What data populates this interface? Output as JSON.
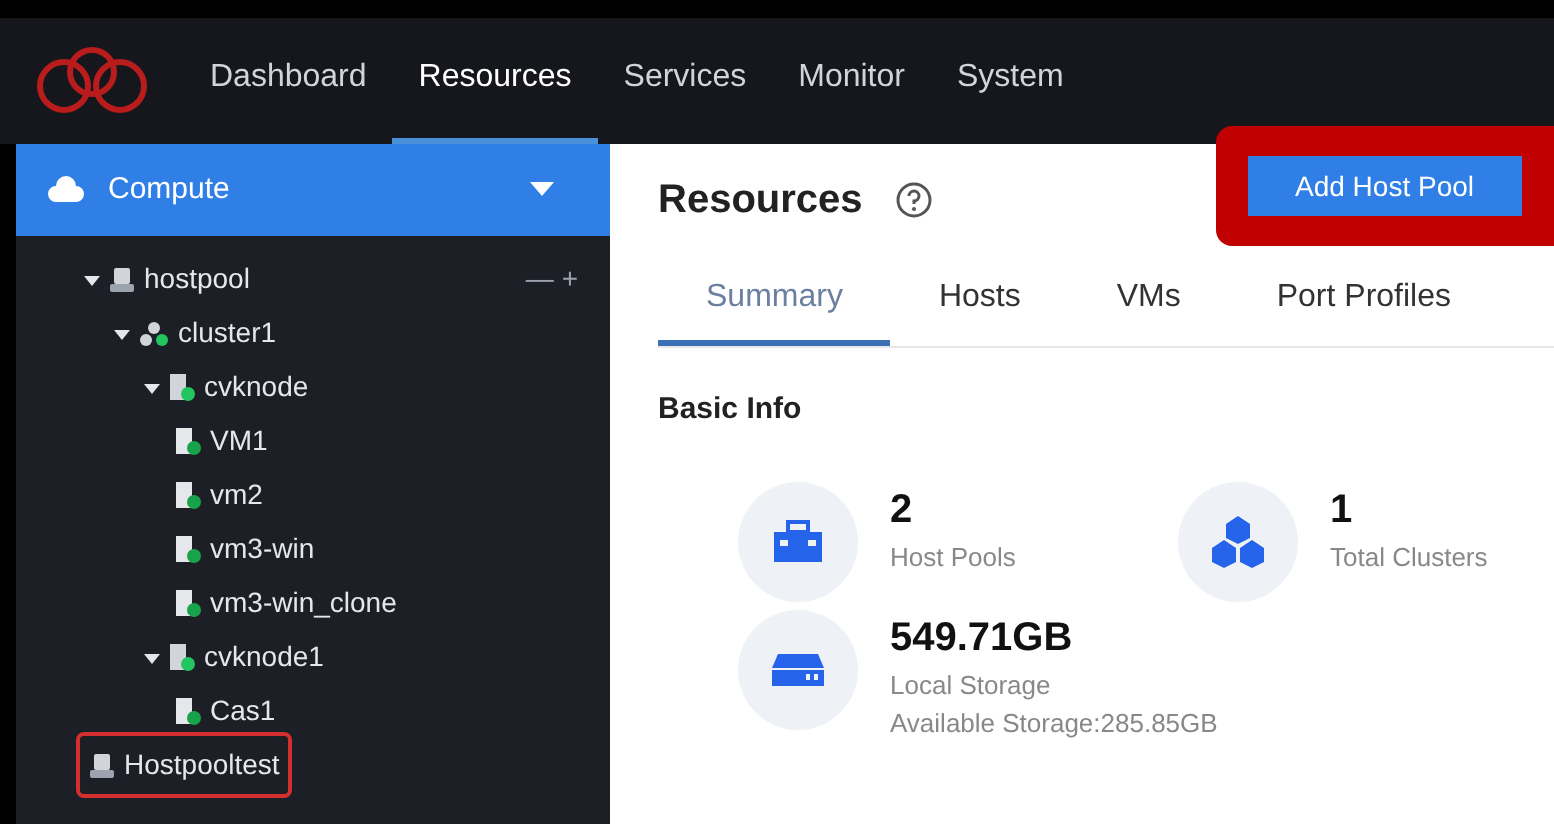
{
  "nav": {
    "items": [
      {
        "label": "Dashboard",
        "selected": false
      },
      {
        "label": "Resources",
        "selected": true
      },
      {
        "label": "Services",
        "selected": false
      },
      {
        "label": "Monitor",
        "selected": false
      },
      {
        "label": "System",
        "selected": false
      }
    ]
  },
  "sidebar": {
    "section": "Compute",
    "tree_controls": [
      "—",
      "+"
    ],
    "tree": [
      {
        "label": "hostpool",
        "kind": "pool",
        "expanded": true,
        "highlighted": false,
        "children": [
          {
            "label": "cluster1",
            "kind": "cluster",
            "expanded": true,
            "highlighted": false,
            "children": [
              {
                "label": "cvknode",
                "kind": "host",
                "expanded": true,
                "highlighted": false,
                "children": [
                  {
                    "label": "VM1",
                    "kind": "vm",
                    "highlighted": false
                  },
                  {
                    "label": "vm2",
                    "kind": "vm",
                    "highlighted": false
                  },
                  {
                    "label": "vm3-win",
                    "kind": "vm",
                    "highlighted": false
                  },
                  {
                    "label": "vm3-win_clone",
                    "kind": "vm",
                    "highlighted": false
                  }
                ]
              },
              {
                "label": "cvknode1",
                "kind": "host",
                "expanded": true,
                "highlighted": false,
                "children": [
                  {
                    "label": "Cas1",
                    "kind": "vm",
                    "highlighted": false
                  }
                ]
              }
            ]
          }
        ]
      },
      {
        "label": "Hostpooltest",
        "kind": "pool",
        "highlighted": true
      }
    ]
  },
  "main": {
    "title": "Resources",
    "button": {
      "label": "Add Host Pool",
      "highlighted": true
    },
    "tabs": [
      {
        "label": "Summary",
        "selected": true
      },
      {
        "label": "Hosts",
        "selected": false
      },
      {
        "label": "VMs",
        "selected": false
      },
      {
        "label": "Port Profiles",
        "selected": false
      }
    ],
    "section": "Basic Info",
    "stats": [
      {
        "kind": "hostpool",
        "value": "2",
        "label": "Host Pools"
      },
      {
        "kind": "cluster",
        "value": "1",
        "label": "Total Clusters"
      },
      {
        "kind": "storage",
        "value": "549.71GB",
        "label": "Local Storage",
        "detail": "Available Storage:285.85GB"
      }
    ]
  }
}
